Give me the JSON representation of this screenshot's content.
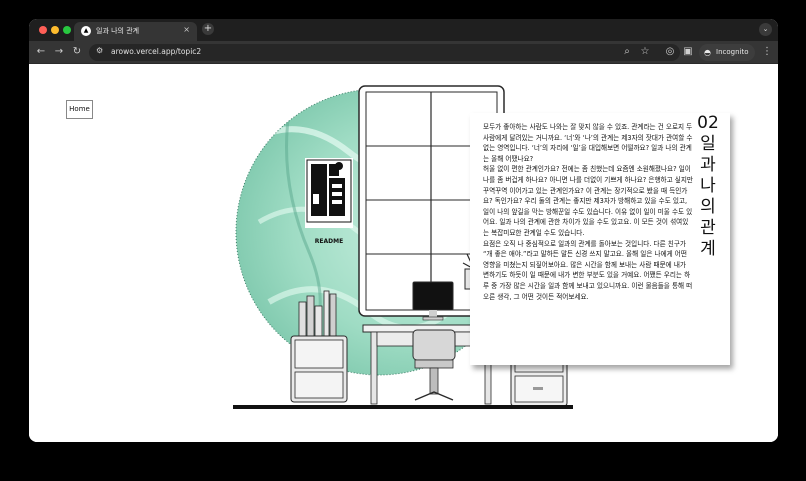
{
  "browser": {
    "tab_title": "일과 나의 관계",
    "url": "arowo.vercel.app/topic2",
    "incognito_label": "Incognito",
    "new_tab_symbol": "+",
    "tab_close_symbol": "×"
  },
  "colors": {
    "close": "#ff5f57",
    "minimize": "#febc2e",
    "maximize": "#28c840",
    "circle_teal": "#9fdcc4"
  },
  "page": {
    "home_label": "Home",
    "poster_label": "README",
    "title_number": "02",
    "title_chars": [
      "일",
      "과",
      "나",
      "의",
      "관",
      "계"
    ],
    "paragraphs": [
      "모두가 좋아하는 사람도 나와는 잘 맞지 않을 수 있죠. 관계라는 건 오로지 두 사람에게 달려있는 거니까요. ‘너’와 ‘나’의 관계는 제3자의 잣대가 관여할 수 없는 영역입니다. ‘너’의 자리에 ‘일’을 대입해보면 어떨까요? 일과 나의 관계는 올해 어땠나요?",
      "허울 없이 편한 관계인가요? 전에는 좀 친했는데 요즘엔 소원해졌나요? 일이 나를 좀 버겁게 하나요? 아니면 나를 더없이 기쁘게 하나요? 은행하고 싶지만 꾸역꾸역 이어가고 있는 관계인가요? 이 관계는 장기적으로 봤을 때 득인가요? 독인가요? 우리 둘의 관계는 좋지만 제3자가 방해하고 있을 수도 있고, 일이 나의 앞길을 막는 방해꾼일 수도 있습니다. 이유 없이 일이 미울 수도 있어요. 일과 나의 관계에 관한 차이가 있을 수도 있고요. 이 모든 것이 섞여있는 복잡미묘한 관계일 수도 있습니다.",
      "요점은 오직 나 중심적으로 일과의 관계를 돌아보는 것입니다. 다른 친구가 “개 좋은 애야.”라고 말하든 말든 신경 쓰지 말고요. 올해 일은 나에게 어떤 영향을 미쳤는지 되짚어보아요. 많은 시간을 함께 보내는 사람 때문에 내가 변하기도 하듯이 일 때문에 내가 변한 부분도 있을 거예요. 어쨌든 우리는 하루 중 가장 많은 시간을 일과 함께 보내고 있으니까요. 이런 물음들을 통해 떠오른 생각, 그 어떤 것이든 적어보세요."
    ]
  }
}
